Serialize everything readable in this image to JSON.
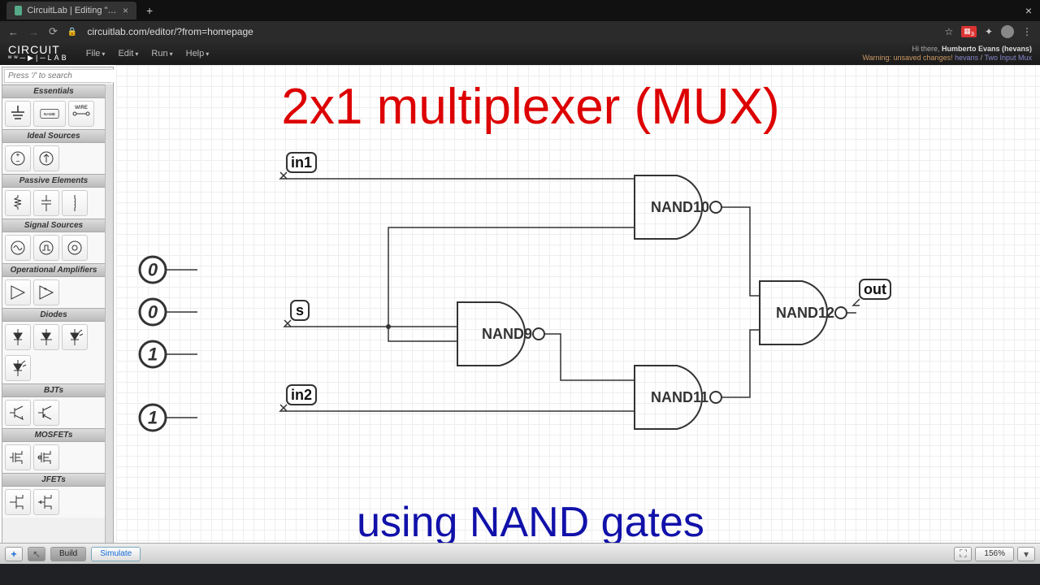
{
  "browser": {
    "tab_title": "CircuitLab | Editing \"Two Inpu",
    "url": "circuitlab.com/editor/?from=homepage",
    "close": "×",
    "newtab": "+"
  },
  "app": {
    "logo_top": "CIRCUIT",
    "logo_bot": "LAB",
    "menus": [
      "File",
      "Edit",
      "Run",
      "Help"
    ],
    "greeting": "Hi there, ",
    "username": "Humberto Evans (hevans)",
    "warning": "Warning: unsaved changes! ",
    "path1": "hevans",
    "path2": "Two Input Mux"
  },
  "sidebar": {
    "search_placeholder": "Press '/' to search",
    "headers": [
      "Essentials",
      "Ideal Sources",
      "Passive Elements",
      "Signal Sources",
      "Operational Amplifiers",
      "Diodes",
      "BJTs",
      "MOSFETs",
      "JFETs"
    ]
  },
  "canvas": {
    "title": "2x1 multiplexer (MUX)",
    "subtitle": "using NAND gates",
    "labels": {
      "in1": "in1",
      "in2": "in2",
      "s": "s",
      "out": "out"
    },
    "gates": {
      "n9": "NAND9",
      "n10": "NAND10",
      "n11": "NAND11",
      "n12": "NAND12"
    },
    "inputs": [
      "0",
      "0",
      "1",
      "1"
    ]
  },
  "bottombar": {
    "build": "Build",
    "simulate": "Simulate",
    "zoom": "156%"
  }
}
